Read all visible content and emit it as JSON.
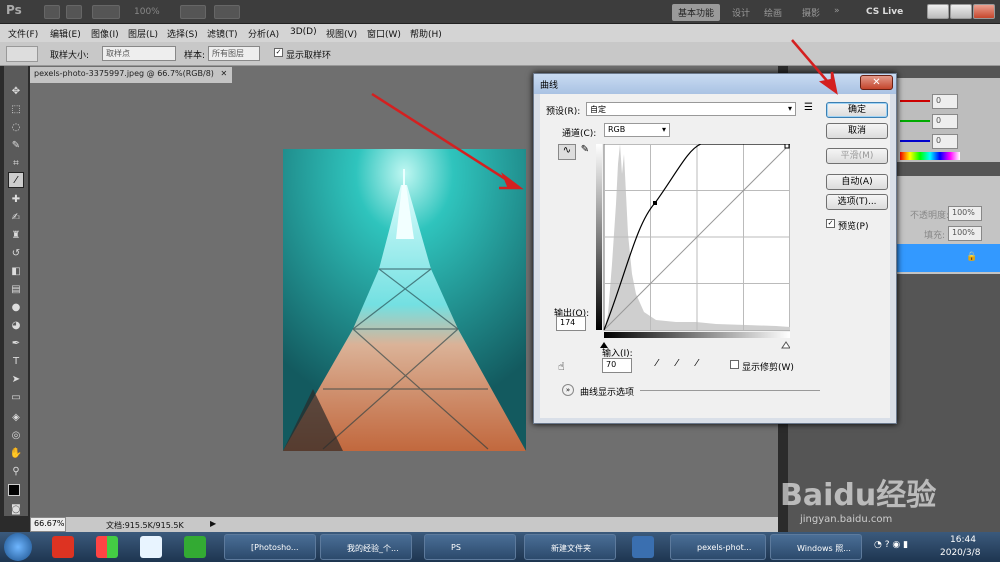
{
  "title_bar": {
    "logo": "Ps",
    "zoom": "100%",
    "workspaces": [
      "基本功能",
      "设计",
      "绘画",
      "摄影"
    ],
    "more": "»",
    "cslive": "CS Live"
  },
  "menu": [
    "文件(F)",
    "编辑(E)",
    "图像(I)",
    "图层(L)",
    "选择(S)",
    "滤镜(T)",
    "分析(A)",
    "3D(D)",
    "视图(V)",
    "窗口(W)",
    "帮助(H)"
  ],
  "options": {
    "sample_size_label": "取样大小:",
    "sample_size_value": "取样点",
    "sample_label": "样本:",
    "sample_value": "所有图层",
    "show_ring": "显示取样环"
  },
  "doc_tab": "pexels-photo-3375997.jpeg @ 66.7%(RGB/8)",
  "status": {
    "zoom": "66.67%",
    "doc_size": "文档:915.5K/915.5K"
  },
  "panels": {
    "rgb_values": [
      "0",
      "0",
      "0"
    ],
    "opacity_label": "不透明度:",
    "opacity": "100%",
    "fill_label": "填充:",
    "fill": "100%"
  },
  "curves": {
    "title": "曲线",
    "preset_label": "预设(R):",
    "preset_value": "自定",
    "channel_label": "通道(C):",
    "channel_value": "RGB",
    "output_label": "输出(O):",
    "output_value": "174",
    "input_label": "输入(I):",
    "input_value": "70",
    "show_clipping": "显示修剪(W)",
    "display_options": "曲线显示选项",
    "buttons": {
      "ok": "确定",
      "cancel": "取消",
      "smooth": "平滑(M)",
      "auto": "自动(A)",
      "options": "选项(T)...",
      "preview": "预览(P)"
    },
    "point": {
      "input": 70,
      "output": 174
    }
  },
  "taskbar": {
    "items": [
      "[Photosho...",
      "我的经验_个...",
      "PS",
      "新建文件夹",
      "pexels-phot...",
      "Windows 照..."
    ],
    "time": "16:44",
    "date": "2020/3/8"
  },
  "watermark": {
    "brand": "Baidu经验",
    "url": "jingyan.baidu.com"
  },
  "colors": {
    "accent_arrow": "#d42020",
    "selection": "#3399ff"
  }
}
